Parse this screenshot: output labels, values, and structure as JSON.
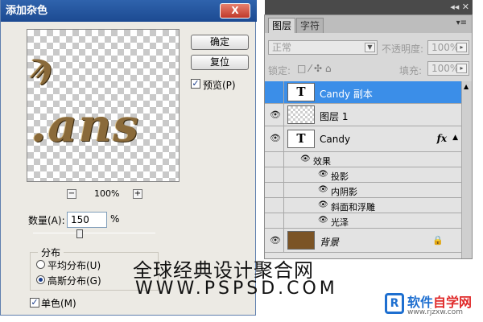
{
  "dialog": {
    "title": "添加杂色",
    "close_label": "X",
    "ok_label": "确定",
    "reset_label": "复位",
    "preview_label": "预览(P)",
    "preview_checked": true,
    "zoom_minus": "−",
    "zoom_value": "100%",
    "zoom_plus": "+",
    "amount_label": "数量(A):",
    "amount_value": "150",
    "amount_unit": "%",
    "distribution_title": "分布",
    "uniform_label": "平均分布(U)",
    "gaussian_label": "高斯分布(G)",
    "selected_distribution": "gaussian",
    "mono_label": "单色(M)",
    "mono_checked": true
  },
  "panel": {
    "tabs": [
      "图层",
      "字符"
    ],
    "active_tab": "图层",
    "blend_mode": "正常",
    "opacity_label": "不透明度:",
    "opacity_value": "100%",
    "lock_label": "锁定:",
    "fill_label": "填充:",
    "fill_value": "100%",
    "layers": [
      {
        "name": "Candy 副本",
        "thumb": "T",
        "visible": false,
        "selected": true
      },
      {
        "name": "图层 1",
        "thumb": "checker",
        "visible": true,
        "selected": false
      },
      {
        "name": "Candy",
        "thumb": "T",
        "visible": true,
        "selected": false,
        "fx": "fx"
      },
      {
        "name": "背景",
        "thumb": "brown",
        "visible": true,
        "selected": false,
        "locked": true
      }
    ],
    "effects_label": "效果",
    "effects": [
      "投影",
      "内阴影",
      "斜面和浮雕",
      "光泽"
    ]
  },
  "watermark": {
    "line1": "全球经典设计聚合网",
    "line2": "WWW.PSPSD.COM"
  },
  "logo": {
    "mark": "R",
    "name_part1": "软件",
    "name_part2": "自学网",
    "url": "www.rjzxw.com"
  },
  "colors": {
    "title_bar": "#1c4a92",
    "selected_row": "#3b8ee8",
    "background_layer": "#7b5426",
    "logo_blue": "#1e6fd0",
    "logo_red": "#e02b2b"
  }
}
